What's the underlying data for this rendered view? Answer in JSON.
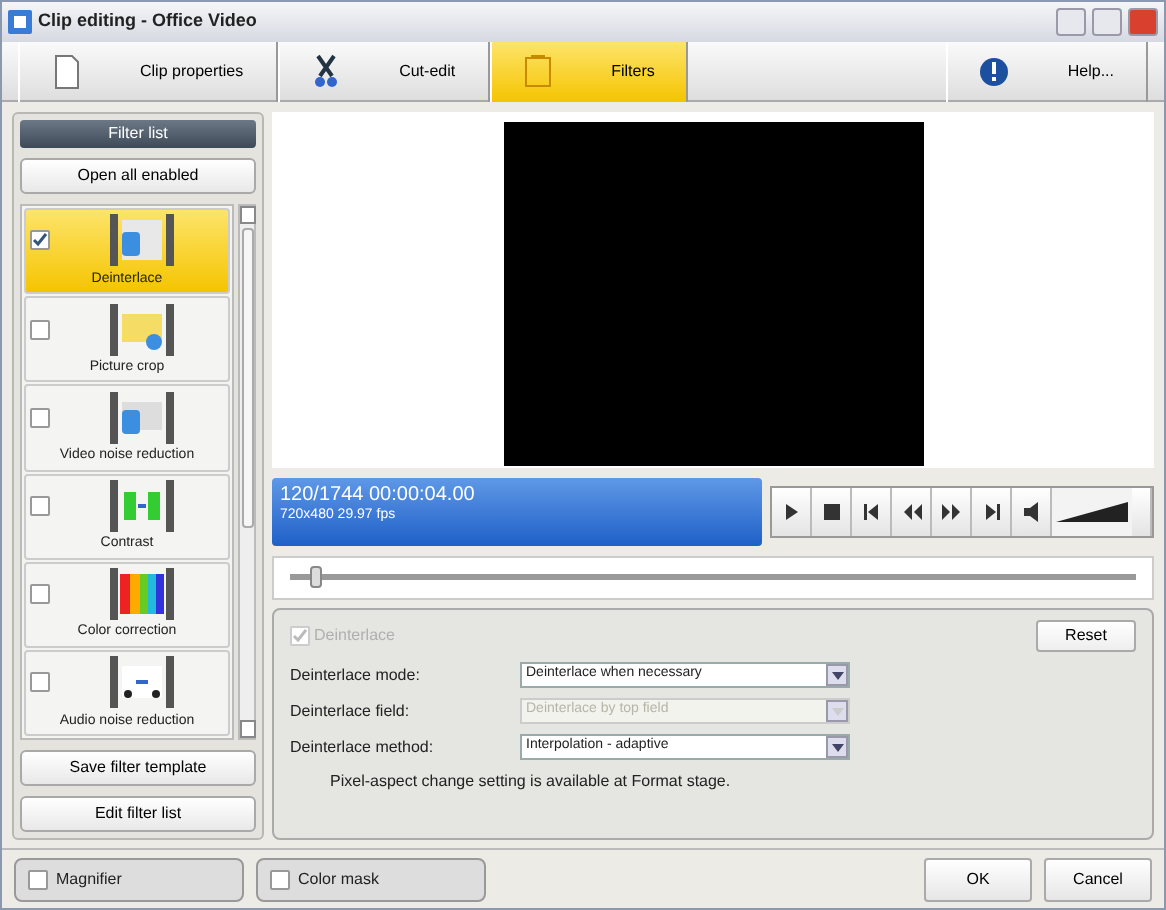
{
  "window": {
    "title": "Clip editing - Office Video"
  },
  "toolbar": [
    {
      "label": "Clip properties",
      "kind": "page",
      "selected": false
    },
    {
      "label": "Cut-edit",
      "kind": "scissors",
      "selected": false
    },
    {
      "label": "Filters",
      "kind": "filter",
      "selected": true
    },
    {
      "label": "Help...",
      "kind": "help",
      "selected": false
    }
  ],
  "filter_list": {
    "title": "Filter list",
    "open_button": "Open all enabled",
    "items": [
      {
        "label": "Deinterlace",
        "kind": "deinterlace",
        "checked": true,
        "selected": true
      },
      {
        "label": "Picture crop",
        "kind": "crop",
        "checked": false,
        "selected": false
      },
      {
        "label": "Video noise reduction",
        "kind": "noise",
        "checked": false,
        "selected": false
      },
      {
        "label": "Contrast",
        "kind": "contrast",
        "checked": false,
        "selected": false
      },
      {
        "label": "Color correction",
        "kind": "color",
        "checked": false,
        "selected": false
      },
      {
        "label": "Audio noise reduction",
        "kind": "audio",
        "checked": false,
        "selected": false
      }
    ],
    "buttons": [
      "Save filter template",
      "Edit filter list"
    ]
  },
  "player": {
    "timecode": "120/1744  00:00:04.00",
    "format": "720x480 29.97 fps",
    "seek": {
      "level": 0.03
    },
    "controls": [
      {
        "kind": "play"
      },
      {
        "kind": "stop"
      },
      {
        "kind": "prev-frame"
      },
      {
        "kind": "rewind"
      },
      {
        "kind": "forward"
      },
      {
        "kind": "next-frame"
      },
      {
        "kind": "volume"
      }
    ]
  },
  "settings": {
    "enable": {
      "label": "Deinterlace",
      "checked": true,
      "disabled": true
    },
    "reset": "Reset",
    "fields": [
      {
        "label": "Deinterlace mode:",
        "value": "Deinterlace when necessary",
        "disabled": false
      },
      {
        "label": "Deinterlace field:",
        "value": "Deinterlace by top field",
        "disabled": true
      },
      {
        "label": "Deinterlace method:",
        "value": "Interpolation - adaptive",
        "disabled": false
      }
    ],
    "note": "Pixel-aspect change setting is available at Format stage."
  },
  "footer": {
    "checks": [
      {
        "label": "Magnifier",
        "checked": false
      },
      {
        "label": "Color mask",
        "checked": false
      }
    ],
    "buttons": [
      "OK",
      "Cancel"
    ]
  }
}
